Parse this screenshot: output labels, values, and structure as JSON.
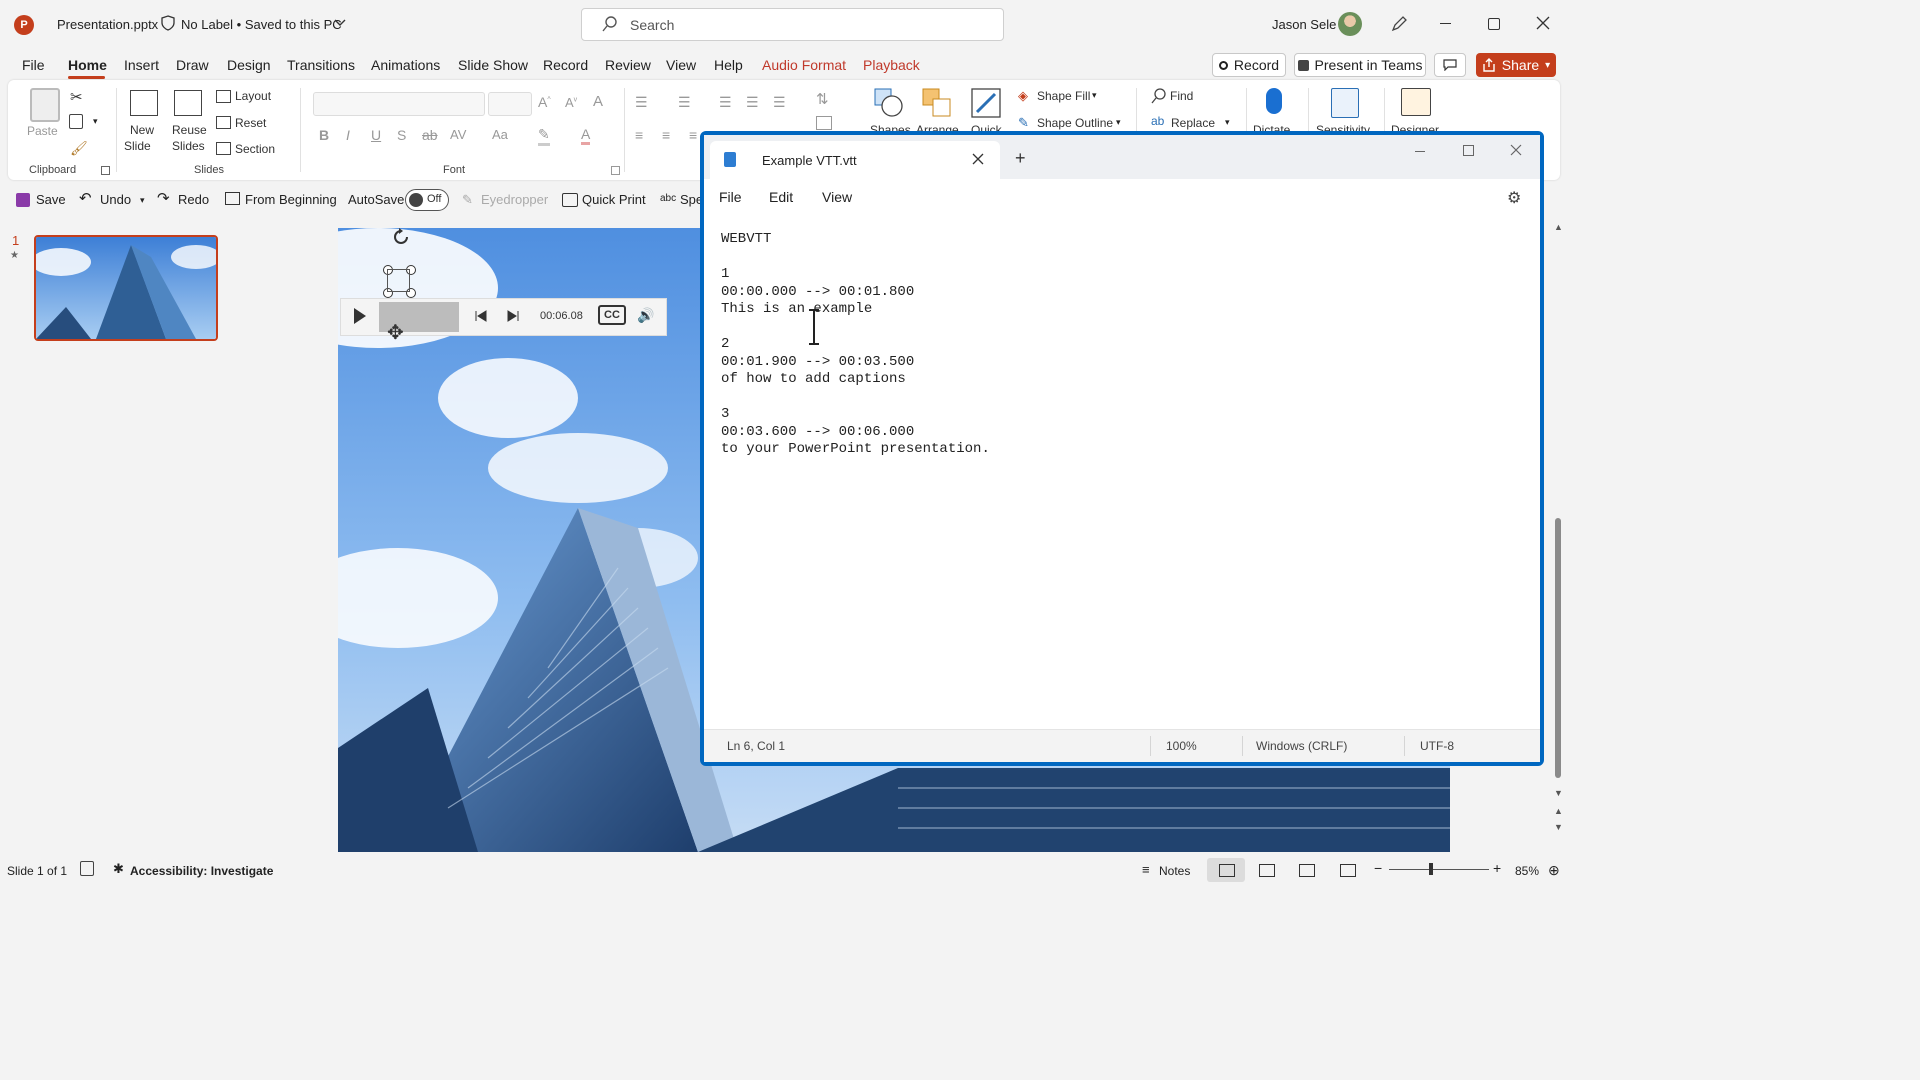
{
  "titlebar": {
    "filename": "Presentation.pptx",
    "label_status": "No Label • Saved to this PC",
    "search_placeholder": "Search",
    "user_name": "Jason Sele"
  },
  "tabs": [
    "File",
    "Home",
    "Insert",
    "Draw",
    "Design",
    "Transitions",
    "Animations",
    "Slide Show",
    "Record",
    "Review",
    "View",
    "Help",
    "Audio Format",
    "Playback"
  ],
  "right_buttons": {
    "record": "Record",
    "present_in_teams": "Present in Teams",
    "share": "Share"
  },
  "ribbon": {
    "paste": "Paste",
    "clipboard": "Clipboard",
    "new_slide_1": "New",
    "new_slide_2": "Slide",
    "reuse_1": "Reuse",
    "reuse_2": "Slides",
    "layout": "Layout",
    "reset": "Reset",
    "section": "Section",
    "slides": "Slides",
    "font": "Font",
    "shape_fill": "Shape Fill",
    "shape_outline": "Shape Outline",
    "find": "Find",
    "replace": "Replace",
    "shapes": "Shapes",
    "arrange": "Arrange",
    "quick": "Quick",
    "dictate": "Dictate",
    "sensitivity": "Sensitivity",
    "designer": "Designer"
  },
  "qat": {
    "save": "Save",
    "undo": "Undo",
    "redo": "Redo",
    "from_beginning": "From Beginning",
    "autosave": "AutoSave",
    "autosave_state": "Off",
    "eyedropper": "Eyedropper",
    "quick_print": "Quick Print",
    "spelling": "Spe"
  },
  "slide_panel": {
    "slide_number": "1"
  },
  "media": {
    "time": "00:06.08",
    "cc": "CC"
  },
  "notepad": {
    "tab_title": "Example VTT.vtt",
    "menu": [
      "File",
      "Edit",
      "View"
    ],
    "content": "WEBVTT\n\n1\n00:00.000 --> 00:01.800\nThis is an example\n\n2\n00:01.900 --> 00:03.500\nof how to add captions\n\n3\n00:03.600 --> 00:06.000\nto your PowerPoint presentation.",
    "status": {
      "position": "Ln 6, Col 1",
      "zoom": "100%",
      "line_endings": "Windows (CRLF)",
      "encoding": "UTF-8"
    }
  },
  "statusbar": {
    "slide_count": "Slide 1 of 1",
    "accessibility": "Accessibility: Investigate",
    "notes": "Notes",
    "zoom": "85%"
  },
  "colors": {
    "accent": "#c43e1c",
    "notepad_border": "#0067c0"
  }
}
